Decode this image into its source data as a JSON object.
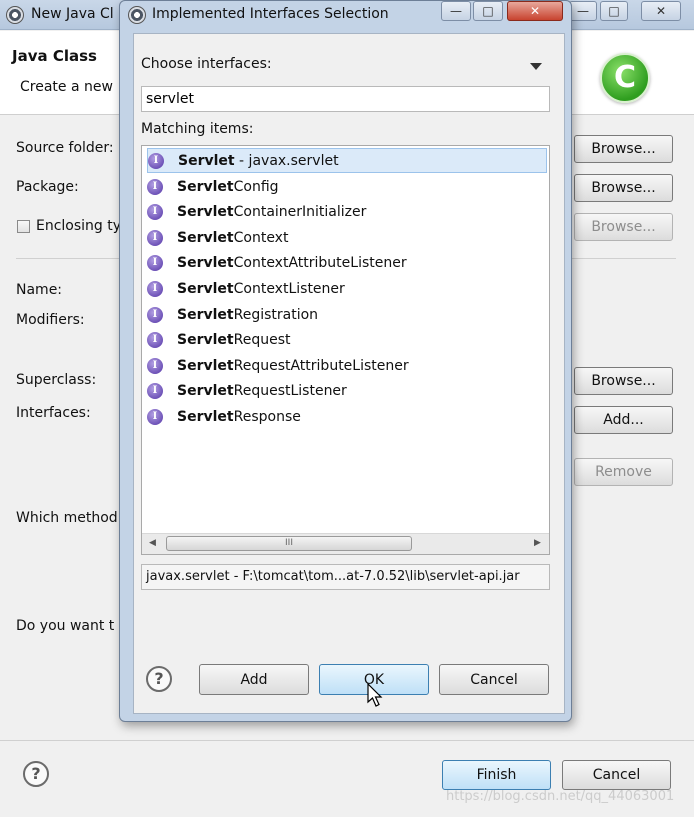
{
  "background_window": {
    "title": "New Java Cl",
    "controls": {
      "minimize": "—",
      "maximize": "□",
      "close": "✕"
    },
    "header": {
      "title": "Java Class",
      "subtitle": "Create a new"
    },
    "labels": {
      "source_folder": "Source folder:",
      "package": "Package:",
      "enclosing_type": "Enclosing ty",
      "name": "Name:",
      "modifiers": "Modifiers:",
      "superclass": "Superclass:",
      "interfaces": "Interfaces:",
      "which_methods": "Which method",
      "do_you_want": "Do you want t"
    },
    "buttons": {
      "browse_source": "Browse...",
      "browse_package": "Browse...",
      "browse_enclosing": "Browse...",
      "browse_superclass": "Browse...",
      "add": "Add...",
      "remove": "Remove",
      "finish": "Finish",
      "cancel": "Cancel"
    },
    "logo_letter": "C",
    "help_glyph": "?",
    "watermark": "https://blog.csdn.net/qq_44063001"
  },
  "dialog": {
    "title": "Implemented Interfaces Selection",
    "choose_label": "Choose interfaces:",
    "search_value": "servlet",
    "matching_label": "Matching items:",
    "items": [
      {
        "bold": "Servlet",
        "rest": " - javax.servlet",
        "selected": true
      },
      {
        "bold": "Servlet",
        "rest": "Config"
      },
      {
        "bold": "Servlet",
        "rest": "ContainerInitializer"
      },
      {
        "bold": "Servlet",
        "rest": "Context"
      },
      {
        "bold": "Servlet",
        "rest": "ContextAttributeListener"
      },
      {
        "bold": "Servlet",
        "rest": "ContextListener"
      },
      {
        "bold": "Servlet",
        "rest": "Registration"
      },
      {
        "bold": "Servlet",
        "rest": "Request"
      },
      {
        "bold": "Servlet",
        "rest": "RequestAttributeListener"
      },
      {
        "bold": "Servlet",
        "rest": "RequestListener"
      },
      {
        "bold": "Servlet",
        "rest": "Response"
      }
    ],
    "scroll_grip": "III",
    "location": "javax.servlet - F:\\tomcat\\tom...at-7.0.52\\lib\\servlet-api.jar",
    "buttons": {
      "add": "Add",
      "ok": "OK",
      "cancel": "Cancel"
    },
    "help_glyph": "?",
    "interface_icon_letter": "I"
  },
  "colors": {
    "selection": "#dbeaf9",
    "titlebar": "#c3d3e6",
    "interface_icon": "#6a4eb5",
    "logo": "#2f9e1f"
  },
  "icons": [
    "app-icon",
    "interface-icon",
    "help-icon",
    "dropdown-arrow-icon",
    "class-logo-icon",
    "mouse-cursor-icon"
  ]
}
